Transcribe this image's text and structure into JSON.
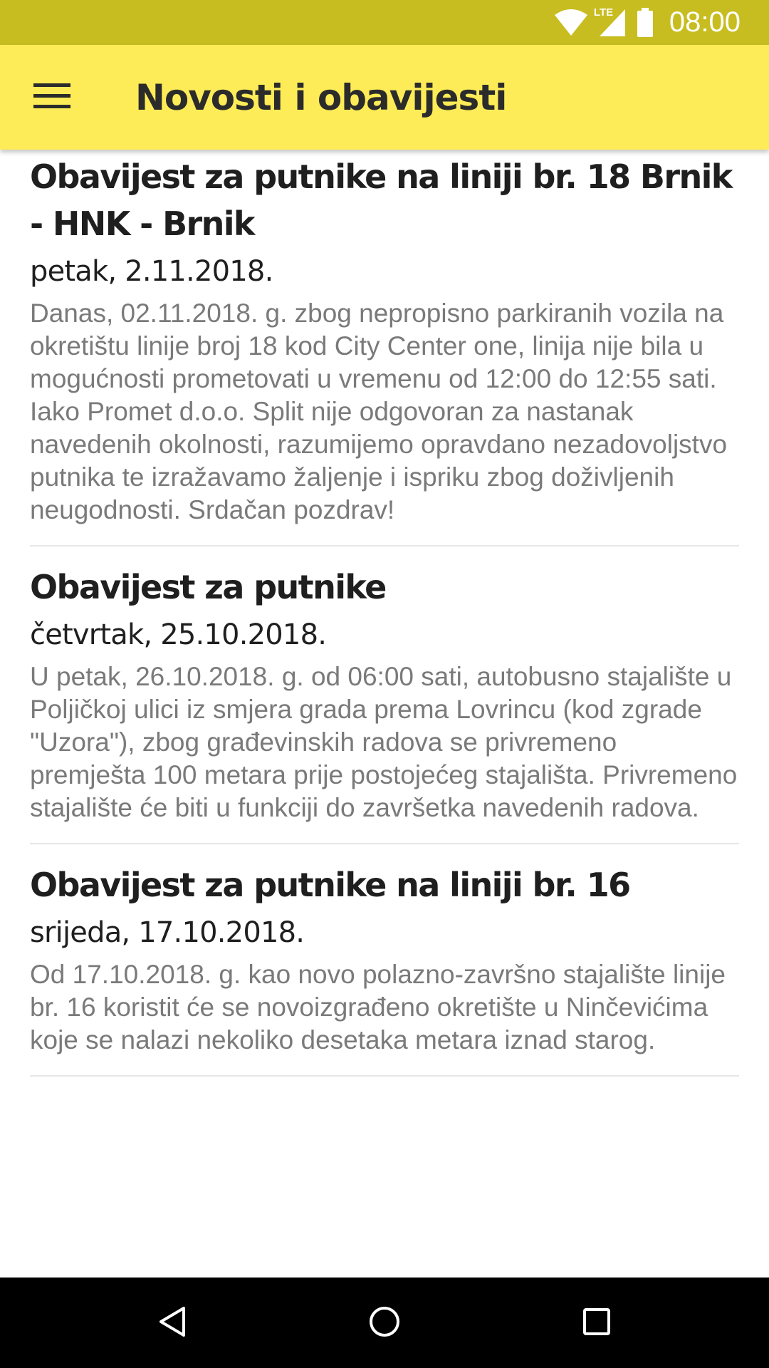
{
  "status_bar": {
    "time": "08:00",
    "network": "LTE",
    "icons": [
      "wifi-icon",
      "signal-icon",
      "battery-icon"
    ]
  },
  "app_bar": {
    "title": "Novosti i obavijesti",
    "menu_icon": "menu-icon"
  },
  "news": [
    {
      "title": "Obavijest za putnike na liniji br. 18 Brnik - HNK - Brnik",
      "date": "petak, 2.11.2018.",
      "body": "Danas, 02.11.2018. g. zbog nepropisno parkiranih vozila na okretištu linije broj 18 kod City Center one, linija nije bila u mogućnosti prometovati u vremenu od 12:00 do 12:55 sati. Iako Promet d.o.o. Split nije odgovoran za nastanak navedenih okolnosti, razumijemo opravdano nezadovoljstvo putnika te izražavamo žaljenje i ispriku zbog doživljenih neugodnosti. Srdačan pozdrav!"
    },
    {
      "title": "Obavijest za putnike",
      "date": "četvrtak, 25.10.2018.",
      "body": "U petak, 26.10.2018. g. od 06:00 sati, autobusno stajalište u Poljičkoj ulici iz smjera grada prema Lovrincu (kod zgrade \"Uzora\"), zbog građevinskih radova se privremeno premješta 100 metara prije postojećeg stajališta. Privremeno stajalište će biti u funkciji do završetka navedenih radova."
    },
    {
      "title": "Obavijest za putnike na liniji br. 16",
      "date": "srijeda, 17.10.2018.",
      "body": "Od 17.10.2018. g. kao novo polazno-završno stajalište linije br. 16 koristit će se novoizgrađeno okretište u Ninčevićima koje se nalazi nekoliko desetaka metara iznad starog."
    }
  ],
  "nav_bar": {
    "icons": [
      "back-icon",
      "home-icon",
      "recents-icon"
    ]
  },
  "colors": {
    "status_bar": "#c8bd20",
    "app_bar": "#fdec57",
    "title_text": "#1f1f1f",
    "body_text": "#7a7a7a",
    "divider": "#e6e6e6",
    "nav_bar": "#000000"
  }
}
